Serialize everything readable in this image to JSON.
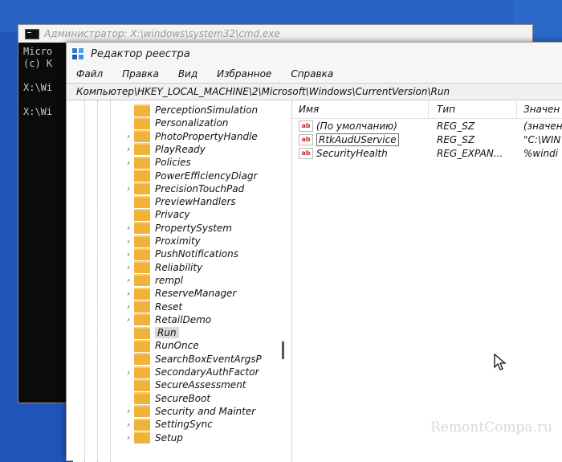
{
  "cmd": {
    "title": "Администратор: X:\\windows\\system32\\cmd.exe",
    "lines": [
      "Micro",
      "(c) K",
      "",
      "X:\\Wi",
      "",
      "X:\\Wi"
    ]
  },
  "regedit": {
    "title": "Редактор реестра",
    "menu": [
      "Файл",
      "Правка",
      "Вид",
      "Избранное",
      "Справка"
    ],
    "address": "Компьютер\\HKEY_LOCAL_MACHINE\\2\\Microsoft\\Windows\\CurrentVersion\\Run",
    "tree": [
      {
        "label": "PerceptionSimulation",
        "expandable": false
      },
      {
        "label": "Personalization",
        "expandable": false
      },
      {
        "label": "PhotoPropertyHandle",
        "expandable": true
      },
      {
        "label": "PlayReady",
        "expandable": true
      },
      {
        "label": "Policies",
        "expandable": true
      },
      {
        "label": "PowerEfficiencyDiagr",
        "expandable": false
      },
      {
        "label": "PrecisionTouchPad",
        "expandable": true
      },
      {
        "label": "PreviewHandlers",
        "expandable": false
      },
      {
        "label": "Privacy",
        "expandable": false
      },
      {
        "label": "PropertySystem",
        "expandable": true
      },
      {
        "label": "Proximity",
        "expandable": true
      },
      {
        "label": "PushNotifications",
        "expandable": true
      },
      {
        "label": "Reliability",
        "expandable": true
      },
      {
        "label": "rempl",
        "expandable": true
      },
      {
        "label": "ReserveManager",
        "expandable": true
      },
      {
        "label": "Reset",
        "expandable": true
      },
      {
        "label": "RetailDemo",
        "expandable": true
      },
      {
        "label": "Run",
        "expandable": false,
        "selected": true
      },
      {
        "label": "RunOnce",
        "expandable": false
      },
      {
        "label": "SearchBoxEventArgsP",
        "expandable": false
      },
      {
        "label": "SecondaryAuthFactor",
        "expandable": true
      },
      {
        "label": "SecureAssessment",
        "expandable": false
      },
      {
        "label": "SecureBoot",
        "expandable": false
      },
      {
        "label": "Security and Mainter",
        "expandable": true
      },
      {
        "label": "SettingSync",
        "expandable": true
      },
      {
        "label": "Setup",
        "expandable": true
      }
    ],
    "columns": {
      "name": "Имя",
      "type": "Тип",
      "data": "Значен"
    },
    "values": [
      {
        "name": "(По умолчанию)",
        "type": "REG_SZ",
        "data": "(значен"
      },
      {
        "name": "RtkAudUService",
        "type": "REG_SZ",
        "data": "\"C:\\WIN"
      },
      {
        "name": "SecurityHealth",
        "type": "REG_EXPAN...",
        "data": "%windi"
      }
    ]
  },
  "watermark": "RemontCompa.ru",
  "colors": {
    "desktop": "#1f55b8",
    "folder": "#f1b23a",
    "ab_icon": "#c0262c"
  }
}
